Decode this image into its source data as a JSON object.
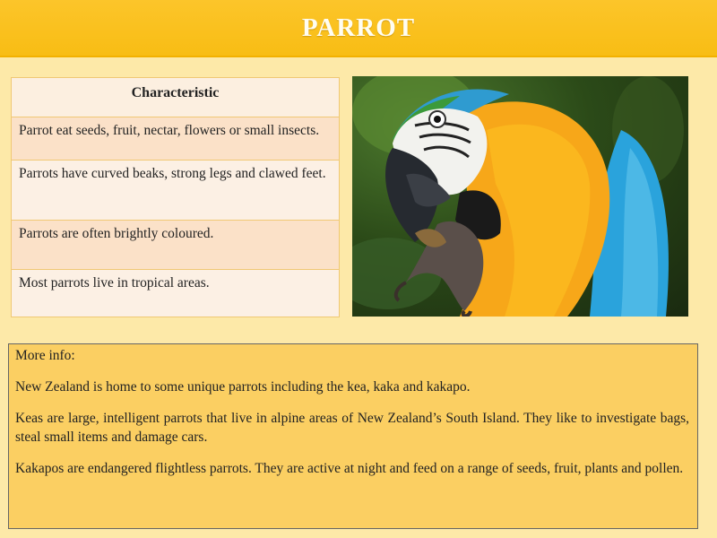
{
  "banner": {
    "title": "PARROT"
  },
  "characteristics": {
    "header": "Characteristic",
    "rows": [
      "Parrot eat seeds, fruit, nectar, flowers or small insects.",
      "Parrots have curved beaks, strong legs and clawed feet.",
      "Parrots are often brightly coloured.",
      "Most parrots live in tropical areas."
    ]
  },
  "photo": {
    "subject": "blue-and-yellow macaw"
  },
  "more_info": {
    "heading": "More info:",
    "paragraphs": [
      "New Zealand is home to some unique parrots including the kea, kaka and kakapo.",
      "Keas are large, intelligent parrots that live in alpine areas of New Zealand’s South Island. They like to investigate bags, steal small items and damage cars.",
      "Kakapos are endangered flightless parrots. They are active at night and feed on a range of seeds, fruit, plants and pollen."
    ]
  },
  "colors": {
    "banner": "#f8bd14",
    "background": "#fde9a8",
    "info_box": "#fbcf62"
  }
}
